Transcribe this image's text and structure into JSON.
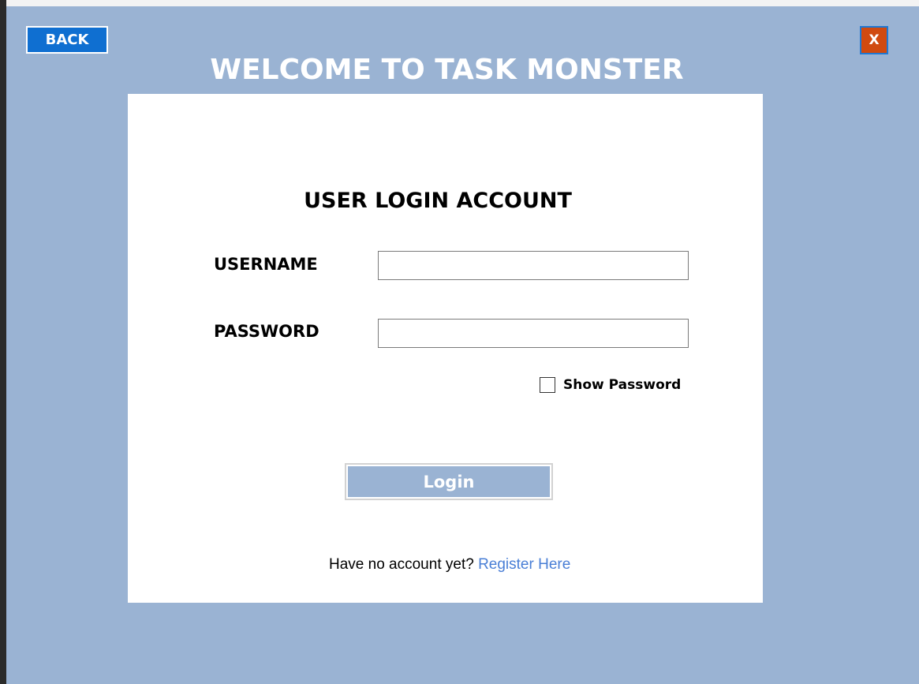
{
  "header": {
    "back_label": "BACK",
    "close_label": "X",
    "welcome_title": "WELCOME TO TASK MONSTER"
  },
  "login_card": {
    "title": "USER LOGIN ACCOUNT",
    "username_label": "USERNAME",
    "username_value": "",
    "password_label": "PASSWORD",
    "password_value": "",
    "show_password_label": "Show Password",
    "show_password_checked": false,
    "login_label": "Login",
    "register_prompt": "Have no account yet?",
    "register_link": "Register Here"
  },
  "colors": {
    "background": "#9ab3d3",
    "back_button": "#0f6fd1",
    "close_button": "#d04a10",
    "link": "#4a7fd6"
  }
}
